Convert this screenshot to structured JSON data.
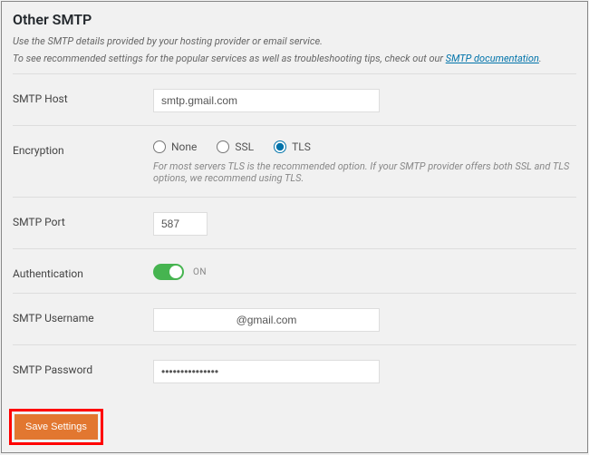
{
  "title": "Other SMTP",
  "desc1": "Use the SMTP details provided by your hosting provider or email service.",
  "desc2_pre": "To see recommended settings for the popular services as well as troubleshooting tips, check out our ",
  "doc_link": "SMTP documentation",
  "desc2_post": ".",
  "labels": {
    "host": "SMTP Host",
    "encryption": "Encryption",
    "port": "SMTP Port",
    "auth": "Authentication",
    "username": "SMTP Username",
    "password": "SMTP Password"
  },
  "values": {
    "host": "smtp.gmail.com",
    "port": "587",
    "username": "@gmail.com",
    "password": "•••••••••••••••"
  },
  "encryption": {
    "none": "None",
    "ssl": "SSL",
    "tls": "TLS",
    "selected": "tls",
    "hint": "For most servers TLS is the recommended option. If your SMTP provider offers both SSL and TLS options, we recommend using TLS."
  },
  "auth": {
    "on_label": "ON",
    "enabled": true
  },
  "save_button": "Save Settings"
}
